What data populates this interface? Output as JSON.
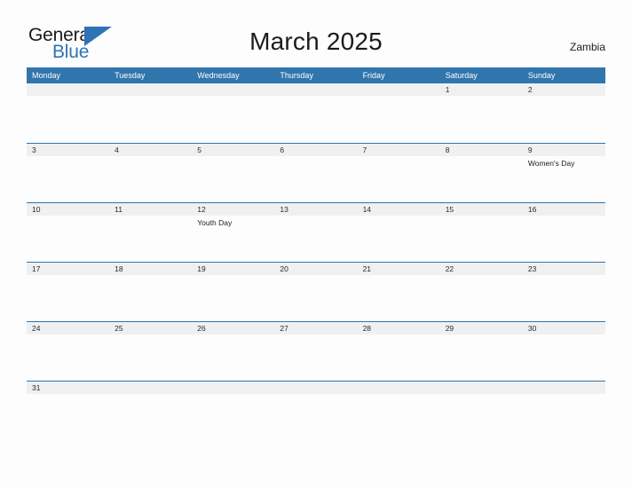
{
  "brand": {
    "name_part1": "General",
    "name_part2": "Blue",
    "triangle_icon": "triangle-icon"
  },
  "header": {
    "title": "March 2025",
    "country": "Zambia"
  },
  "colors": {
    "header_blue": "#3175AD",
    "brand_blue": "#2E74B5",
    "date_band_gray": "#F0F0F0",
    "text_dark": "#1B1B1B",
    "page_background": "#FDFDFD"
  },
  "calendar": {
    "weekdays": [
      "Monday",
      "Tuesday",
      "Wednesday",
      "Thursday",
      "Friday",
      "Saturday",
      "Sunday"
    ],
    "weeks": [
      {
        "days": [
          {
            "date": "",
            "event": ""
          },
          {
            "date": "",
            "event": ""
          },
          {
            "date": "",
            "event": ""
          },
          {
            "date": "",
            "event": ""
          },
          {
            "date": "",
            "event": ""
          },
          {
            "date": "1",
            "event": ""
          },
          {
            "date": "2",
            "event": ""
          }
        ]
      },
      {
        "days": [
          {
            "date": "3",
            "event": ""
          },
          {
            "date": "4",
            "event": ""
          },
          {
            "date": "5",
            "event": ""
          },
          {
            "date": "6",
            "event": ""
          },
          {
            "date": "7",
            "event": ""
          },
          {
            "date": "8",
            "event": ""
          },
          {
            "date": "9",
            "event": "Women's Day"
          }
        ]
      },
      {
        "days": [
          {
            "date": "10",
            "event": ""
          },
          {
            "date": "11",
            "event": ""
          },
          {
            "date": "12",
            "event": "Youth Day"
          },
          {
            "date": "13",
            "event": ""
          },
          {
            "date": "14",
            "event": ""
          },
          {
            "date": "15",
            "event": ""
          },
          {
            "date": "16",
            "event": ""
          }
        ]
      },
      {
        "days": [
          {
            "date": "17",
            "event": ""
          },
          {
            "date": "18",
            "event": ""
          },
          {
            "date": "19",
            "event": ""
          },
          {
            "date": "20",
            "event": ""
          },
          {
            "date": "21",
            "event": ""
          },
          {
            "date": "22",
            "event": ""
          },
          {
            "date": "23",
            "event": ""
          }
        ]
      },
      {
        "days": [
          {
            "date": "24",
            "event": ""
          },
          {
            "date": "25",
            "event": ""
          },
          {
            "date": "26",
            "event": ""
          },
          {
            "date": "27",
            "event": ""
          },
          {
            "date": "28",
            "event": ""
          },
          {
            "date": "29",
            "event": ""
          },
          {
            "date": "30",
            "event": ""
          }
        ]
      },
      {
        "days": [
          {
            "date": "31",
            "event": ""
          },
          {
            "date": "",
            "event": ""
          },
          {
            "date": "",
            "event": ""
          },
          {
            "date": "",
            "event": ""
          },
          {
            "date": "",
            "event": ""
          },
          {
            "date": "",
            "event": ""
          },
          {
            "date": "",
            "event": ""
          }
        ]
      }
    ]
  }
}
